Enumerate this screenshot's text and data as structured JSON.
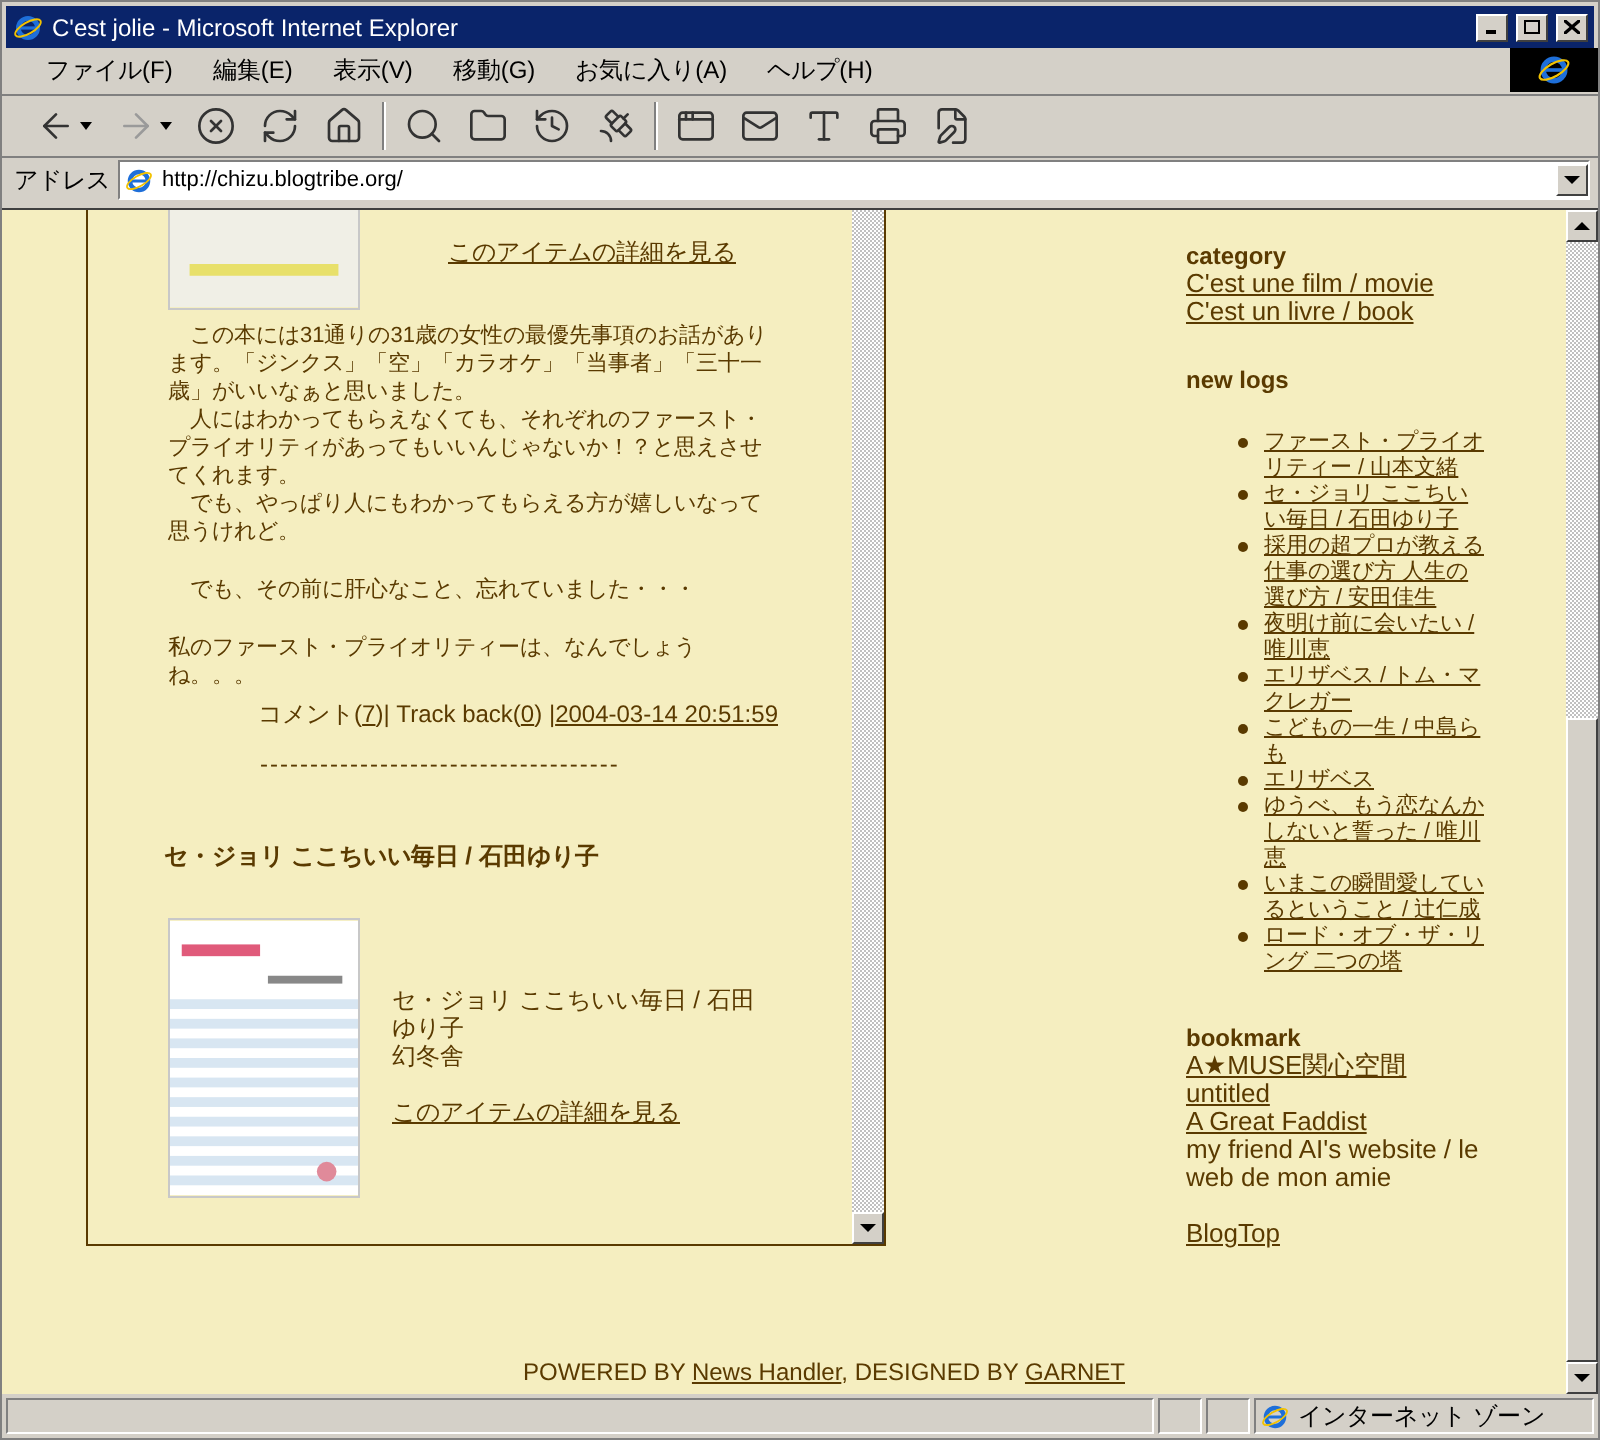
{
  "window": {
    "title": "C'est jolie - Microsoft Internet Explorer"
  },
  "menu": [
    "ファイル(F)",
    "編集(E)",
    "表示(V)",
    "移動(G)",
    "お気に入り(A)",
    "ヘルプ(H)"
  ],
  "address": {
    "label": "アドレス",
    "url": "http://chizu.blogtribe.org/"
  },
  "entry_top": {
    "detail_link": "このアイテムの詳細を見る",
    "paragraphs": [
      "　この本には31通りの31歳の女性の最優先事項のお話があります。「ジンクス」「空」「カラオケ」「当事者」「三十一歳」がいいなぁと思いました。",
      "　人にはわかってもらえなくても、それぞれのファースト・プライオリティがあってもいいんじゃないか！？と思えさせてくれます。",
      "　でも、やっぱり人にもわかってもらえる方が嬉しいなって思うけれど。",
      "　でも、その前に肝心なこと、忘れていました・・・",
      "私のファースト・プライオリティーは、なんでしょうね。。。"
    ],
    "meta": [
      {
        "text": "コメント(",
        "link": false
      },
      {
        "text": "7",
        "link": true
      },
      {
        "text": ")| Track back(",
        "link": false
      },
      {
        "text": "0",
        "link": true
      },
      {
        "text": ") |",
        "link": false
      },
      {
        "text": "2004-03-14 20:51:59",
        "link": true
      }
    ],
    "separator": "------------------------------------"
  },
  "entry": {
    "title": "セ・ジョリ ここちいい毎日 / 石田ゆり子",
    "book_title": "セ・ジョリ ここちいい毎日 / 石田ゆり子",
    "publisher": "幻冬舎",
    "detail_link": "このアイテムの詳細を見る"
  },
  "sidebar": {
    "category": {
      "heading": "category",
      "links": [
        "C'est une film / movie",
        "C'est un livre / book"
      ]
    },
    "new_logs": {
      "heading": "new logs",
      "items": [
        "ファースト・プライオリティー / 山本文緒",
        "セ・ジョリ ここちいい毎日 / 石田ゆり子",
        "採用の超プロが教える仕事の選び方 人生の選び方 / 安田佳生",
        "夜明け前に会いたい / 唯川恵",
        "エリザベス / トム・マクレガー",
        "こどもの一生 / 中島らも",
        "エリザベス",
        "ゆうべ、もう恋なんかしないと誓った / 唯川恵",
        "いまこの瞬間愛しているということ / 辻仁成",
        "ロード・オブ・ザ・リング 二つの塔"
      ]
    },
    "bookmark": {
      "heading": "bookmark",
      "items": [
        {
          "kind": "link",
          "text": "A★MUSE関心空間"
        },
        {
          "kind": "link",
          "text": "untitled"
        },
        {
          "kind": "link",
          "text": "A Great Faddist"
        },
        {
          "kind": "text",
          "text": "my friend AI's website / le web de mon amie"
        }
      ]
    },
    "top_link": "BlogTop"
  },
  "footer": [
    {
      "text": "POWERED BY ",
      "link": false
    },
    {
      "text": "News Handler",
      "link": true
    },
    {
      "text": ", DESIGNED BY ",
      "link": false
    },
    {
      "text": "GARNET",
      "link": true
    }
  ],
  "status_bar": {
    "zone": "インターネット ゾーン"
  }
}
